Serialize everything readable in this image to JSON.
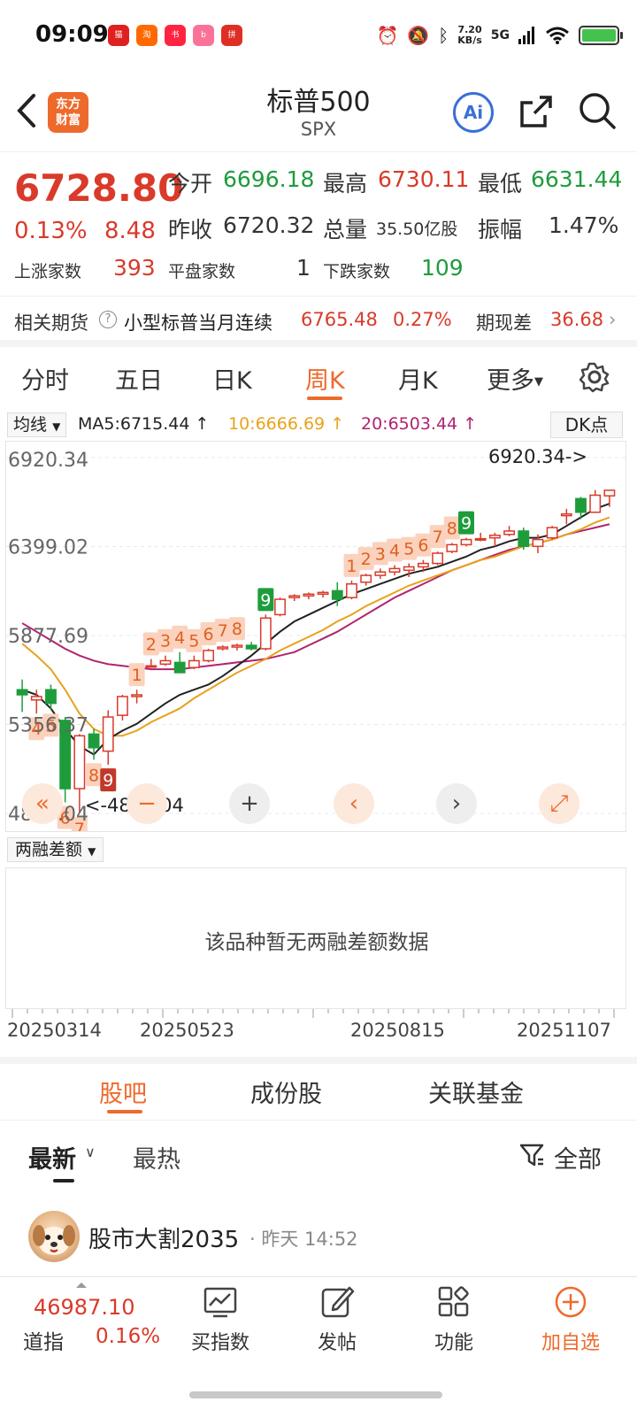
{
  "status_bar": {
    "time": "09:09",
    "app_icons": [
      {
        "name": "tmall-icon",
        "color": "#e02020",
        "label": "天猫"
      },
      {
        "name": "taobao-icon",
        "color": "#ff6a00",
        "label": "淘"
      },
      {
        "name": "xiaohongshu-icon",
        "color": "#ff2442",
        "label": "小红书"
      },
      {
        "name": "bilibili-icon",
        "color": "#fb7299",
        "label": "bili"
      },
      {
        "name": "pinduoduo-icon",
        "color": "#e02e24",
        "label": "拼"
      }
    ],
    "net_speed_value": "7.20",
    "net_speed_unit": "KB/s",
    "signal": "5G",
    "battery_level": 1.0
  },
  "header": {
    "back_label": "<",
    "logo_line1": "东方",
    "logo_line2": "财富",
    "title": "标普500",
    "subtitle": "SPX",
    "ai_label": "Ai"
  },
  "quote": {
    "last_price": "6728.80",
    "change_pct": "0.13%",
    "change_abs": "8.48",
    "open_label": "今开",
    "open": "6696.18",
    "high_label": "最高",
    "high": "6730.11",
    "low_label": "最低",
    "low": "6631.44",
    "prev_close_label": "昨收",
    "prev_close": "6720.32",
    "volume_label": "总量",
    "volume": "35.50亿股",
    "amplitude_label": "振幅",
    "amplitude": "1.47%",
    "up_label": "上涨家数",
    "up_count": "393",
    "flat_label": "平盘家数",
    "flat_count": "1",
    "down_label": "下跌家数",
    "down_count": "109"
  },
  "futures": {
    "label": "相关期货",
    "contract": "小型标普当月连续",
    "price": "6765.48",
    "pct": "0.27%",
    "basis_label": "期现差",
    "basis": "36.68"
  },
  "period_tabs": [
    "分时",
    "五日",
    "日K",
    "周K",
    "月K",
    "更多"
  ],
  "period_active": "周K",
  "ma_row": {
    "select_label": "均线",
    "ma5": "MA5:6715.44",
    "ma10": "10:6666.69",
    "ma20": "20:6503.44",
    "dk_label": "DK点",
    "colors": {
      "ma5": "#222222",
      "ma10": "#e8a21c",
      "ma20": "#b0246f"
    }
  },
  "chart_data": {
    "type": "candlestick",
    "y_tick_labels": [
      "6920.34",
      "6399.02",
      "5877.69",
      "5356.37",
      "4835.04"
    ],
    "ylim": [
      4835.04,
      6920.34
    ],
    "max_annotation": "6920.34->",
    "min_annotation": "<-4835.04",
    "candles": [
      {
        "o": 5560,
        "h": 5620,
        "l": 5430,
        "c": 5530
      },
      {
        "o": 5500,
        "h": 5560,
        "l": 5420,
        "c": 5520
      },
      {
        "o": 5560,
        "h": 5590,
        "l": 5440,
        "c": 5480
      },
      {
        "o": 5380,
        "h": 5400,
        "l": 4900,
        "c": 4980
      },
      {
        "o": 4980,
        "h": 5300,
        "l": 4835.04,
        "c": 5290
      },
      {
        "o": 5300,
        "h": 5330,
        "l": 5150,
        "c": 5220
      },
      {
        "o": 5200,
        "h": 5440,
        "l": 5120,
        "c": 5400
      },
      {
        "o": 5410,
        "h": 5530,
        "l": 5380,
        "c": 5520
      },
      {
        "o": 5520,
        "h": 5560,
        "l": 5480,
        "c": 5530
      },
      {
        "o": 5700,
        "h": 5740,
        "l": 5690,
        "c": 5700
      },
      {
        "o": 5710,
        "h": 5760,
        "l": 5700,
        "c": 5730
      },
      {
        "o": 5720,
        "h": 5780,
        "l": 5700,
        "c": 5660
      },
      {
        "o": 5690,
        "h": 5760,
        "l": 5680,
        "c": 5730
      },
      {
        "o": 5730,
        "h": 5800,
        "l": 5720,
        "c": 5790
      },
      {
        "o": 5800,
        "h": 5820,
        "l": 5790,
        "c": 5810
      },
      {
        "o": 5810,
        "h": 5830,
        "l": 5790,
        "c": 5820
      },
      {
        "o": 5820,
        "h": 5840,
        "l": 5790,
        "c": 5800
      },
      {
        "o": 5800,
        "h": 6000,
        "l": 5790,
        "c": 5980
      },
      {
        "o": 6000,
        "h": 6100,
        "l": 5990,
        "c": 6090
      },
      {
        "o": 6100,
        "h": 6120,
        "l": 6080,
        "c": 6110
      },
      {
        "o": 6110,
        "h": 6130,
        "l": 6090,
        "c": 6120
      },
      {
        "o": 6120,
        "h": 6140,
        "l": 6100,
        "c": 6130
      },
      {
        "o": 6140,
        "h": 6190,
        "l": 6050,
        "c": 6090
      },
      {
        "o": 6100,
        "h": 6200,
        "l": 6090,
        "c": 6180
      },
      {
        "o": 6190,
        "h": 6240,
        "l": 6170,
        "c": 6230
      },
      {
        "o": 6230,
        "h": 6270,
        "l": 6210,
        "c": 6250
      },
      {
        "o": 6250,
        "h": 6290,
        "l": 6230,
        "c": 6270
      },
      {
        "o": 6260,
        "h": 6300,
        "l": 6220,
        "c": 6280
      },
      {
        "o": 6280,
        "h": 6320,
        "l": 6250,
        "c": 6300
      },
      {
        "o": 6300,
        "h": 6370,
        "l": 6290,
        "c": 6360
      },
      {
        "o": 6370,
        "h": 6420,
        "l": 6360,
        "c": 6410
      },
      {
        "o": 6410,
        "h": 6450,
        "l": 6400,
        "c": 6440
      },
      {
        "o": 6440,
        "h": 6480,
        "l": 6430,
        "c": 6445
      },
      {
        "o": 6450,
        "h": 6480,
        "l": 6400,
        "c": 6465
      },
      {
        "o": 6470,
        "h": 6520,
        "l": 6460,
        "c": 6490
      },
      {
        "o": 6490,
        "h": 6510,
        "l": 6380,
        "c": 6400
      },
      {
        "o": 6400,
        "h": 6470,
        "l": 6360,
        "c": 6440
      },
      {
        "o": 6450,
        "h": 6520,
        "l": 6440,
        "c": 6510
      },
      {
        "o": 6580,
        "h": 6620,
        "l": 6530,
        "c": 6590
      },
      {
        "o": 6680,
        "h": 6690,
        "l": 6560,
        "c": 6600
      },
      {
        "o": 6600,
        "h": 6730.11,
        "l": 6600,
        "c": 6700
      },
      {
        "o": 6696.18,
        "h": 6730.11,
        "l": 6631.44,
        "c": 6728.8
      }
    ],
    "candle_colors": {
      "up": "#d93a2a",
      "down": "#1e9c3c"
    },
    "ma5": [
      5560,
      5530,
      5450,
      5330,
      5230,
      5180,
      5270,
      5320,
      5360,
      5420,
      5480,
      5530,
      5560,
      5590,
      5640,
      5700,
      5760,
      5830,
      5900,
      5960,
      6000,
      6040,
      6080,
      6120,
      6150,
      6180,
      6210,
      6240,
      6260,
      6280,
      6310,
      6340,
      6380,
      6400,
      6430,
      6450,
      6450,
      6470,
      6520,
      6570,
      6620,
      6650
    ],
    "ma10": [
      5830,
      5760,
      5680,
      5560,
      5420,
      5330,
      5290,
      5290,
      5320,
      5370,
      5410,
      5450,
      5510,
      5560,
      5610,
      5660,
      5700,
      5740,
      5790,
      5830,
      5870,
      5910,
      5960,
      6000,
      6050,
      6090,
      6130,
      6170,
      6200,
      6230,
      6260,
      6290,
      6320,
      6340,
      6370,
      6400,
      6420,
      6440,
      6470,
      6500,
      6540,
      6570
    ],
    "ma20": [
      5950,
      5900,
      5850,
      5800,
      5760,
      5730,
      5710,
      5700,
      5690,
      5680,
      5680,
      5680,
      5690,
      5700,
      5710,
      5720,
      5730,
      5740,
      5760,
      5780,
      5820,
      5860,
      5900,
      5950,
      6000,
      6050,
      6100,
      6140,
      6180,
      6220,
      6260,
      6290,
      6320,
      6350,
      6380,
      6400,
      6420,
      6440,
      6470,
      6490,
      6510,
      6530
    ],
    "markers": [
      {
        "i": 1,
        "t": "4"
      },
      {
        "i": 2,
        "t": "5"
      },
      {
        "i": 3,
        "t": "6"
      },
      {
        "i": 4,
        "t": "7"
      },
      {
        "i": 5,
        "t": "8"
      },
      {
        "i": 6,
        "t": "9"
      },
      {
        "i": 8,
        "t": "1"
      },
      {
        "i": 9,
        "t": "2"
      },
      {
        "i": 10,
        "t": "3"
      },
      {
        "i": 11,
        "t": "4"
      },
      {
        "i": 12,
        "t": "5"
      },
      {
        "i": 13,
        "t": "6"
      },
      {
        "i": 14,
        "t": "7"
      },
      {
        "i": 15,
        "t": "8"
      },
      {
        "i": 17,
        "t": "9"
      },
      {
        "i": 23,
        "t": "1"
      },
      {
        "i": 24,
        "t": "2"
      },
      {
        "i": 25,
        "t": "3"
      },
      {
        "i": 26,
        "t": "4"
      },
      {
        "i": 27,
        "t": "5"
      },
      {
        "i": 28,
        "t": "6"
      },
      {
        "i": 29,
        "t": "7"
      },
      {
        "i": 30,
        "t": "8"
      },
      {
        "i": 31,
        "t": "9"
      }
    ],
    "date_labels": [
      "20250314",
      "20250523",
      "20250815",
      "20251107"
    ]
  },
  "chart_controls": {
    "first_label": "«",
    "zoom_out_label": "−",
    "zoom_in_label": "+",
    "prev_label": "‹",
    "next_label": "›",
    "fullscreen_label": "⤢"
  },
  "margin": {
    "select_label": "两融差额",
    "empty_text": "该品种暂无两融差额数据"
  },
  "content_tabs": [
    "股吧",
    "成份股",
    "关联基金"
  ],
  "content_active": "股吧",
  "sort": {
    "latest": "最新",
    "hot": "最热",
    "filter_label": "全部"
  },
  "post": {
    "author": "股市大割2035",
    "time": "· 昨天 14:52"
  },
  "bottom_bar": {
    "dow_value": "46987.10",
    "dow_name": "道指",
    "dow_pct": "0.16%",
    "items": [
      {
        "name": "buy-index",
        "label": "买指数"
      },
      {
        "name": "post",
        "label": "发帖"
      },
      {
        "name": "functions",
        "label": "功能"
      },
      {
        "name": "add-watchlist",
        "label": "加自选"
      }
    ]
  }
}
